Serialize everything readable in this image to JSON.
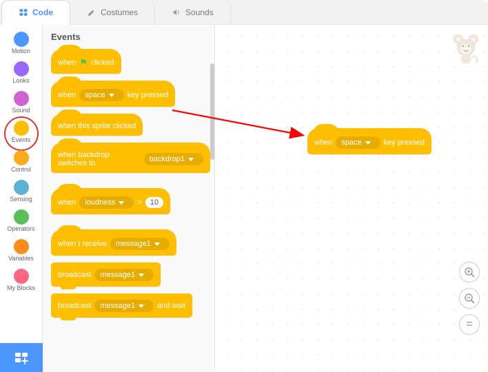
{
  "tabs": {
    "code": "Code",
    "costumes": "Costumes",
    "sounds": "Sounds"
  },
  "categories": {
    "motion": {
      "label": "Motion",
      "color": "#4c97ff"
    },
    "looks": {
      "label": "Looks",
      "color": "#9966ff"
    },
    "sound": {
      "label": "Sound",
      "color": "#cf63cf"
    },
    "events": {
      "label": "Events",
      "color": "#ffbf00"
    },
    "control": {
      "label": "Control",
      "color": "#ffab19"
    },
    "sensing": {
      "label": "Sensing",
      "color": "#5cb1d6"
    },
    "operators": {
      "label": "Operators",
      "color": "#59c059"
    },
    "variables": {
      "label": "Variables",
      "color": "#ff8c1a"
    },
    "myblocks": {
      "label": "My Blocks",
      "color": "#ff6680"
    }
  },
  "palette": {
    "title": "Events",
    "blocks": {
      "whenFlag": {
        "pre": "when",
        "post": "clicked"
      },
      "whenKey": {
        "pre": "when",
        "slot": "space",
        "post": "key pressed"
      },
      "whenSprite": {
        "text": "when this sprite clicked"
      },
      "whenBackdrop": {
        "pre": "when backdrop switches to",
        "slot": "backdrop1"
      },
      "whenLoudness": {
        "pre": "when",
        "slot": "loudness",
        "op": ">",
        "num": "10"
      },
      "whenReceive": {
        "pre": "when I receive",
        "slot": "message1"
      },
      "broadcast": {
        "pre": "broadcast",
        "slot": "message1"
      },
      "broadcastWait": {
        "pre": "broadcast",
        "slot": "message1",
        "post": "and wait"
      }
    }
  },
  "workspace": {
    "block": {
      "pre": "when",
      "slot": "space",
      "post": "key pressed"
    }
  },
  "zoom": {
    "in": "+",
    "out": "−",
    "reset": "="
  },
  "sprite": "🐵"
}
